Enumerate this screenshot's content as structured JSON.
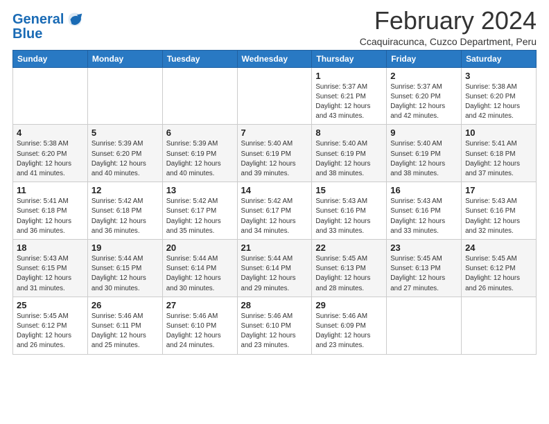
{
  "header": {
    "logo_line1": "General",
    "logo_line2": "Blue",
    "month_title": "February 2024",
    "location": "Ccaquiracunca, Cuzco Department, Peru"
  },
  "weekdays": [
    "Sunday",
    "Monday",
    "Tuesday",
    "Wednesday",
    "Thursday",
    "Friday",
    "Saturday"
  ],
  "weeks": [
    [
      {
        "day": "",
        "info": ""
      },
      {
        "day": "",
        "info": ""
      },
      {
        "day": "",
        "info": ""
      },
      {
        "day": "",
        "info": ""
      },
      {
        "day": "1",
        "info": "Sunrise: 5:37 AM\nSunset: 6:21 PM\nDaylight: 12 hours\nand 43 minutes."
      },
      {
        "day": "2",
        "info": "Sunrise: 5:37 AM\nSunset: 6:20 PM\nDaylight: 12 hours\nand 42 minutes."
      },
      {
        "day": "3",
        "info": "Sunrise: 5:38 AM\nSunset: 6:20 PM\nDaylight: 12 hours\nand 42 minutes."
      }
    ],
    [
      {
        "day": "4",
        "info": "Sunrise: 5:38 AM\nSunset: 6:20 PM\nDaylight: 12 hours\nand 41 minutes."
      },
      {
        "day": "5",
        "info": "Sunrise: 5:39 AM\nSunset: 6:20 PM\nDaylight: 12 hours\nand 40 minutes."
      },
      {
        "day": "6",
        "info": "Sunrise: 5:39 AM\nSunset: 6:19 PM\nDaylight: 12 hours\nand 40 minutes."
      },
      {
        "day": "7",
        "info": "Sunrise: 5:40 AM\nSunset: 6:19 PM\nDaylight: 12 hours\nand 39 minutes."
      },
      {
        "day": "8",
        "info": "Sunrise: 5:40 AM\nSunset: 6:19 PM\nDaylight: 12 hours\nand 38 minutes."
      },
      {
        "day": "9",
        "info": "Sunrise: 5:40 AM\nSunset: 6:19 PM\nDaylight: 12 hours\nand 38 minutes."
      },
      {
        "day": "10",
        "info": "Sunrise: 5:41 AM\nSunset: 6:18 PM\nDaylight: 12 hours\nand 37 minutes."
      }
    ],
    [
      {
        "day": "11",
        "info": "Sunrise: 5:41 AM\nSunset: 6:18 PM\nDaylight: 12 hours\nand 36 minutes."
      },
      {
        "day": "12",
        "info": "Sunrise: 5:42 AM\nSunset: 6:18 PM\nDaylight: 12 hours\nand 36 minutes."
      },
      {
        "day": "13",
        "info": "Sunrise: 5:42 AM\nSunset: 6:17 PM\nDaylight: 12 hours\nand 35 minutes."
      },
      {
        "day": "14",
        "info": "Sunrise: 5:42 AM\nSunset: 6:17 PM\nDaylight: 12 hours\nand 34 minutes."
      },
      {
        "day": "15",
        "info": "Sunrise: 5:43 AM\nSunset: 6:16 PM\nDaylight: 12 hours\nand 33 minutes."
      },
      {
        "day": "16",
        "info": "Sunrise: 5:43 AM\nSunset: 6:16 PM\nDaylight: 12 hours\nand 33 minutes."
      },
      {
        "day": "17",
        "info": "Sunrise: 5:43 AM\nSunset: 6:16 PM\nDaylight: 12 hours\nand 32 minutes."
      }
    ],
    [
      {
        "day": "18",
        "info": "Sunrise: 5:43 AM\nSunset: 6:15 PM\nDaylight: 12 hours\nand 31 minutes."
      },
      {
        "day": "19",
        "info": "Sunrise: 5:44 AM\nSunset: 6:15 PM\nDaylight: 12 hours\nand 30 minutes."
      },
      {
        "day": "20",
        "info": "Sunrise: 5:44 AM\nSunset: 6:14 PM\nDaylight: 12 hours\nand 30 minutes."
      },
      {
        "day": "21",
        "info": "Sunrise: 5:44 AM\nSunset: 6:14 PM\nDaylight: 12 hours\nand 29 minutes."
      },
      {
        "day": "22",
        "info": "Sunrise: 5:45 AM\nSunset: 6:13 PM\nDaylight: 12 hours\nand 28 minutes."
      },
      {
        "day": "23",
        "info": "Sunrise: 5:45 AM\nSunset: 6:13 PM\nDaylight: 12 hours\nand 27 minutes."
      },
      {
        "day": "24",
        "info": "Sunrise: 5:45 AM\nSunset: 6:12 PM\nDaylight: 12 hours\nand 26 minutes."
      }
    ],
    [
      {
        "day": "25",
        "info": "Sunrise: 5:45 AM\nSunset: 6:12 PM\nDaylight: 12 hours\nand 26 minutes."
      },
      {
        "day": "26",
        "info": "Sunrise: 5:46 AM\nSunset: 6:11 PM\nDaylight: 12 hours\nand 25 minutes."
      },
      {
        "day": "27",
        "info": "Sunrise: 5:46 AM\nSunset: 6:10 PM\nDaylight: 12 hours\nand 24 minutes."
      },
      {
        "day": "28",
        "info": "Sunrise: 5:46 AM\nSunset: 6:10 PM\nDaylight: 12 hours\nand 23 minutes."
      },
      {
        "day": "29",
        "info": "Sunrise: 5:46 AM\nSunset: 6:09 PM\nDaylight: 12 hours\nand 23 minutes."
      },
      {
        "day": "",
        "info": ""
      },
      {
        "day": "",
        "info": ""
      }
    ]
  ]
}
